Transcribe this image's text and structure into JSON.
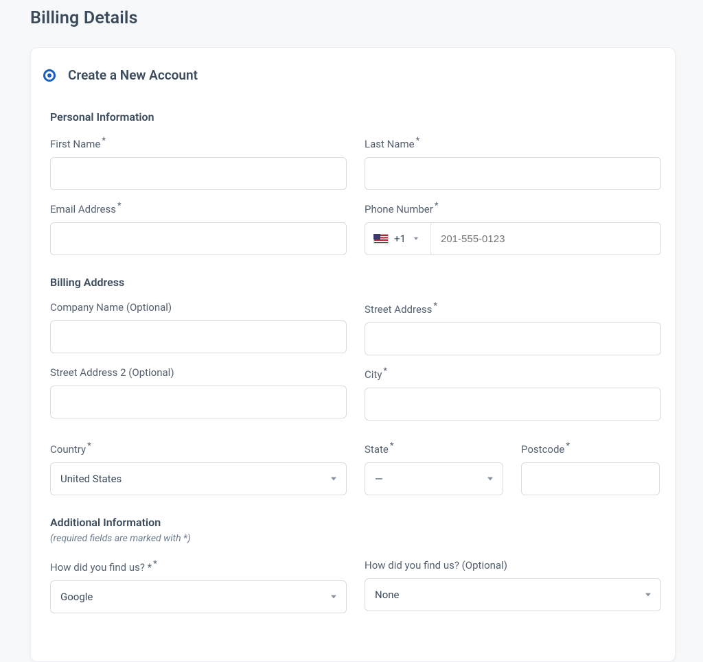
{
  "page": {
    "title": "Billing Details"
  },
  "account_option": {
    "label": "Create a New Account",
    "selected": true
  },
  "sections": {
    "personal": {
      "heading": "Personal Information"
    },
    "billing": {
      "heading": "Billing Address"
    },
    "additional": {
      "heading": "Additional Information",
      "note": "(required fields are marked with *)"
    }
  },
  "fields": {
    "first_name": {
      "label": "First Name",
      "required": true,
      "value": ""
    },
    "last_name": {
      "label": "Last Name",
      "required": true,
      "value": ""
    },
    "email": {
      "label": "Email Address",
      "required": true,
      "value": ""
    },
    "phone": {
      "label": "Phone Number",
      "required": true,
      "dial_code": "+1",
      "country_flag": "us",
      "placeholder": "201-555-0123",
      "value": ""
    },
    "company": {
      "label": "Company Name (Optional)",
      "required": false,
      "value": ""
    },
    "street1": {
      "label": "Street Address",
      "required": true,
      "value": ""
    },
    "street2": {
      "label": "Street Address 2 (Optional)",
      "required": false,
      "value": ""
    },
    "city": {
      "label": "City",
      "required": true,
      "value": ""
    },
    "country": {
      "label": "Country",
      "required": true,
      "value": "United States"
    },
    "state": {
      "label": "State",
      "required": true,
      "value": "—"
    },
    "postcode": {
      "label": "Postcode",
      "required": true,
      "value": ""
    },
    "found_us_req": {
      "label": "How did you find us? *",
      "required": true,
      "value": "Google"
    },
    "found_us_opt": {
      "label": "How did you find us? (Optional)",
      "required": false,
      "value": "None"
    }
  },
  "required_marker": "*"
}
